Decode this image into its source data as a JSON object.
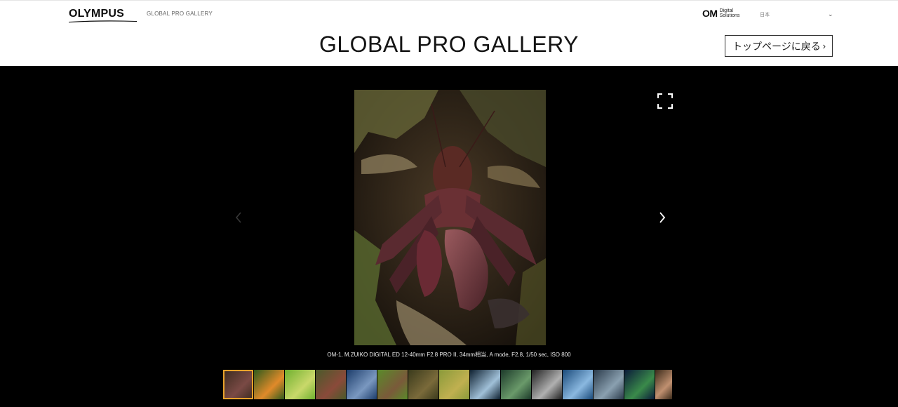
{
  "header": {
    "brand_logo": "OLYMPUS",
    "brand_sub": "GLOBAL PRO GALLERY",
    "om_mark": "OM",
    "om_text_line1": "Digital",
    "om_text_line2": "Solutions",
    "language": "日本",
    "page_title": "GLOBAL PRO GALLERY",
    "back_button_label": "トップページに戻る"
  },
  "gallery": {
    "caption": "OM-1, M.ZUIKO DIGITAL ED 12-40mm F2.8 PRO II, 34mm相当, A mode, F2.8, 1/50 sec, ISO 800",
    "active_index": 0,
    "thumbnails": [
      {
        "theme": "crab",
        "colors": [
          "#3a2a1e",
          "#7a4a45"
        ]
      },
      {
        "theme": "butterfly",
        "colors": [
          "#2f5a1c",
          "#e08a2a"
        ]
      },
      {
        "theme": "snail-leaf",
        "colors": [
          "#6fb02f",
          "#c9d86a"
        ]
      },
      {
        "theme": "bird-branch",
        "colors": [
          "#4a5a2a",
          "#8a4a3a"
        ]
      },
      {
        "theme": "seascape-dusk",
        "colors": [
          "#1c3c6a",
          "#7a98c0"
        ]
      },
      {
        "theme": "deer-meadow",
        "colors": [
          "#5a8a2a",
          "#7a5a3a"
        ]
      },
      {
        "theme": "forest-floor",
        "colors": [
          "#3a3a1c",
          "#7a6a3a"
        ]
      },
      {
        "theme": "grassland",
        "colors": [
          "#8a9a3a",
          "#c0b050"
        ]
      },
      {
        "theme": "waterfall",
        "colors": [
          "#0e2030",
          "#a0c0d8"
        ]
      },
      {
        "theme": "mossy-stream",
        "colors": [
          "#1c3a2a",
          "#6a9a6a"
        ]
      },
      {
        "theme": "misty-trees",
        "colors": [
          "#202020",
          "#b0b0b0"
        ]
      },
      {
        "theme": "waves-blue",
        "colors": [
          "#1a4a7a",
          "#8ab8e0"
        ]
      },
      {
        "theme": "rough-sea",
        "colors": [
          "#2a3a4a",
          "#8aa0b0"
        ]
      },
      {
        "theme": "night-lights",
        "colors": [
          "#0a1a3a",
          "#3a8a4a"
        ]
      },
      {
        "theme": "person",
        "colors": [
          "#3a2a1a",
          "#c09070"
        ]
      }
    ]
  },
  "icons": {
    "fullscreen": "fullscreen-icon",
    "prev": "chevron-left-icon",
    "next": "chevron-right-icon",
    "dropdown": "chevron-down-icon"
  },
  "colors": {
    "gallery_bg": "#000000",
    "active_thumb_border": "#e8a22a",
    "header_bg": "#ffffff"
  }
}
